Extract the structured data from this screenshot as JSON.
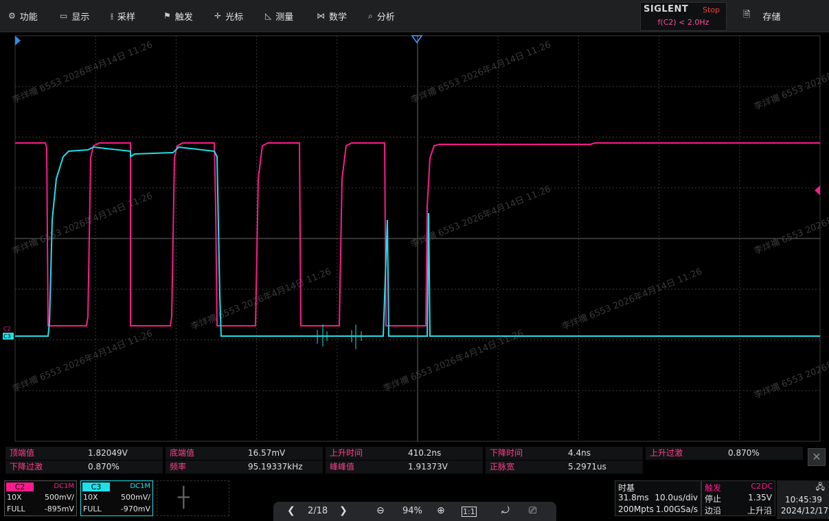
{
  "menu": {
    "items": [
      {
        "label": "功能",
        "icon": "gear-icon",
        "glyph": "⚙"
      },
      {
        "label": "显示",
        "icon": "monitor-icon",
        "glyph": "▭"
      },
      {
        "label": "采样",
        "icon": "acquire-icon",
        "glyph": "⫲"
      },
      {
        "label": "触发",
        "icon": "trigger-flag-icon",
        "glyph": "⚑"
      },
      {
        "label": "光标",
        "icon": "cursor-icon",
        "glyph": "✛"
      },
      {
        "label": "测量",
        "icon": "measure-icon",
        "glyph": "◺"
      },
      {
        "label": "数学",
        "icon": "math-icon",
        "glyph": "⋈"
      },
      {
        "label": "分析",
        "icon": "analysis-icon",
        "glyph": "⌕"
      }
    ],
    "save_label": "存储",
    "save_icon": "save-icon"
  },
  "brand": {
    "logo": "SIGLENT",
    "status": "Stop",
    "frequency": "f(C2) < 2.0Hz"
  },
  "watermark": "李烊禰 6553 2026年4月14日 11:26",
  "markers": {
    "c2": "C2",
    "c3": "C3"
  },
  "measurements": {
    "row1": [
      {
        "label": "顶端值",
        "value": "1.82049V"
      },
      {
        "label": "底端值",
        "value": "16.57mV"
      },
      {
        "label": "上升时间",
        "value": "410.2ns"
      },
      {
        "label": "下降时间",
        "value": "4.4ns"
      },
      {
        "label": "上升过激",
        "value": "0.870%"
      }
    ],
    "row2": [
      {
        "label": "下降过激",
        "value": "0.870%"
      },
      {
        "label": "频率",
        "value": "95.19337kHz"
      },
      {
        "label": "峰峰值",
        "value": "1.91373V"
      },
      {
        "label": "正脉宽",
        "value": "5.2971us"
      }
    ]
  },
  "channels": [
    {
      "name": "C2",
      "coupling": "DC1M",
      "probe": "10X",
      "scale": "500mV/",
      "bw": "FULL",
      "offset": "-895mV",
      "color": "#ff1a8c"
    },
    {
      "name": "C3",
      "coupling": "DC1M",
      "probe": "10X",
      "scale": "500mV/",
      "bw": "FULL",
      "offset": "-970mV",
      "color": "#1fe0e8"
    }
  ],
  "toolbar": {
    "page": "2/18",
    "zoom": "94%"
  },
  "timebase": {
    "title": "时基",
    "length": "31.8ms",
    "scale": "10.0us/div",
    "points": "200Mpts",
    "rate": "1.00GSa/s"
  },
  "trigger": {
    "title": "触发",
    "source": "C2",
    "coupling": "DC",
    "state": "停止",
    "level": "1.35V",
    "type": "边沿",
    "slope": "上升沿"
  },
  "clock": {
    "time": "10:45:39",
    "date": "2024/12/17",
    "network_icon": "network-icon"
  }
}
